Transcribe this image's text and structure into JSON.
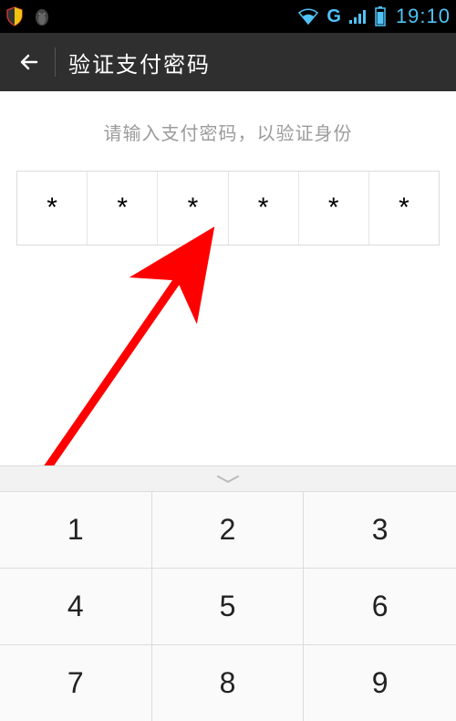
{
  "status_bar": {
    "network_label": "G",
    "time": "19:10",
    "icon_color": "#4fc3f7"
  },
  "header": {
    "title": "验证支付密码"
  },
  "content": {
    "prompt": "请输入支付密码，以验证身份",
    "pin_mask": [
      "*",
      "*",
      "*",
      "*",
      "*",
      "*"
    ]
  },
  "keypad": {
    "keys": [
      "1",
      "2",
      "3",
      "4",
      "5",
      "6",
      "7",
      "8",
      "9"
    ]
  },
  "annotation": {
    "arrow_color": "#ff0000"
  }
}
